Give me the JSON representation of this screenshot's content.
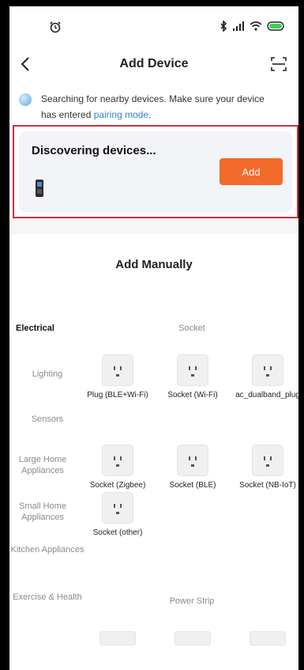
{
  "navbar": {
    "title": "Add Device"
  },
  "hint": {
    "text_before_link": "Searching for nearby devices. Make sure your device has entered ",
    "link_text": "pairing mode",
    "text_after_link": "."
  },
  "discovering": {
    "title": "Discovering devices...",
    "add_label": "Add"
  },
  "manual": {
    "title": "Add Manually",
    "categories": [
      "Electrical",
      "Lighting",
      "Sensors",
      "Large Home Appliances",
      "Small Home Appliances",
      "Kitchen Appliances",
      "Exercise & Health"
    ],
    "active_category": "Electrical",
    "sections": [
      {
        "label": "Socket",
        "devices": [
          {
            "name": "Plug (BLE+Wi-Fi)",
            "icon": "socket-icon"
          },
          {
            "name": "Socket (Wi-Fi)",
            "icon": "socket-icon"
          },
          {
            "name": "ac_dualband_plug",
            "icon": "socket-icon"
          },
          {
            "name": "Socket (Zigbee)",
            "icon": "socket-icon"
          },
          {
            "name": "Socket (BLE)",
            "icon": "socket-icon"
          },
          {
            "name": "Socket (NB-IoT)",
            "icon": "socket-icon"
          },
          {
            "name": "Socket (other)",
            "icon": "socket-icon"
          }
        ]
      },
      {
        "label": "Power Strip",
        "devices": [
          {
            "icon": "power-strip-icon"
          },
          {
            "icon": "power-strip-icon"
          },
          {
            "icon": "power-strip-icon"
          }
        ]
      }
    ]
  },
  "colors": {
    "accent": "#f26b2a",
    "link": "#3b82c4",
    "highlight_border": "#c8323a"
  }
}
